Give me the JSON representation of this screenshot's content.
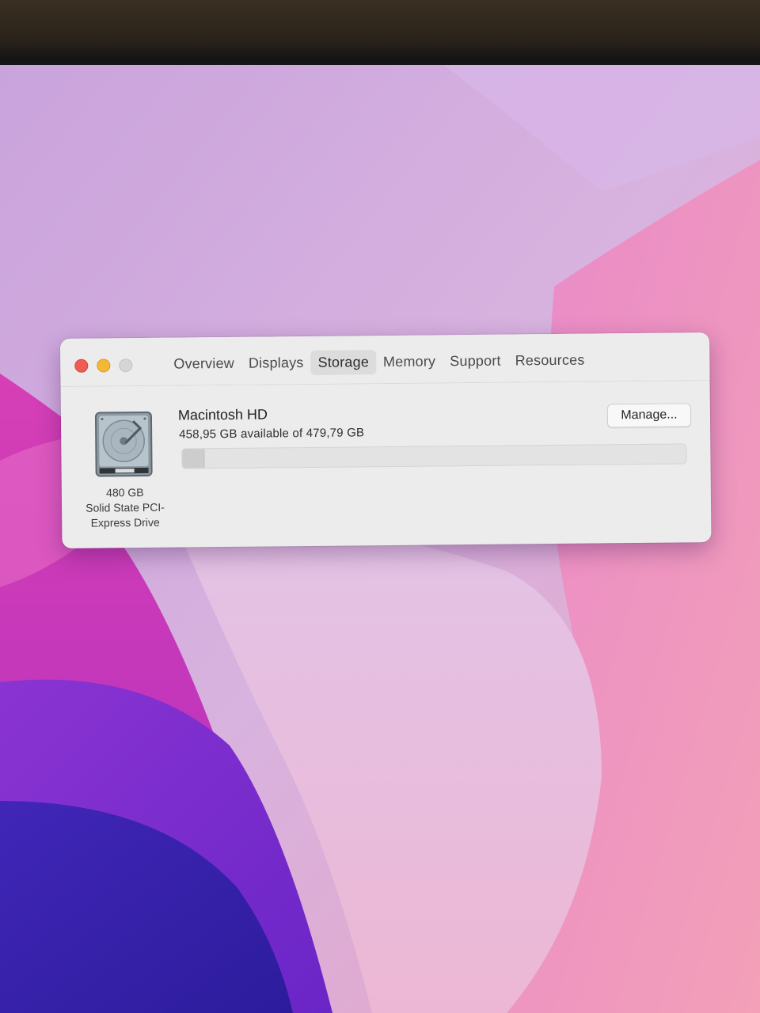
{
  "window": {
    "tabs": [
      {
        "label": "Overview"
      },
      {
        "label": "Displays"
      },
      {
        "label": "Storage",
        "active": true
      },
      {
        "label": "Memory"
      },
      {
        "label": "Support"
      },
      {
        "label": "Resources"
      }
    ]
  },
  "storage": {
    "drive": {
      "capacity": "480 GB",
      "type_line1": "Solid State PCI-",
      "type_line2": "Express Drive"
    },
    "volume": {
      "name": "Macintosh HD",
      "detail": "458,95 GB available of 479,79 GB",
      "used_fraction": 0.043
    },
    "manage_label": "Manage..."
  },
  "colors": {
    "close": "#ee5d53",
    "minimize": "#f3b936",
    "zoom_inactive": "#d6d6d6",
    "window_bg": "#ececec"
  },
  "icons": {
    "drive": "hard-drive-icon"
  }
}
